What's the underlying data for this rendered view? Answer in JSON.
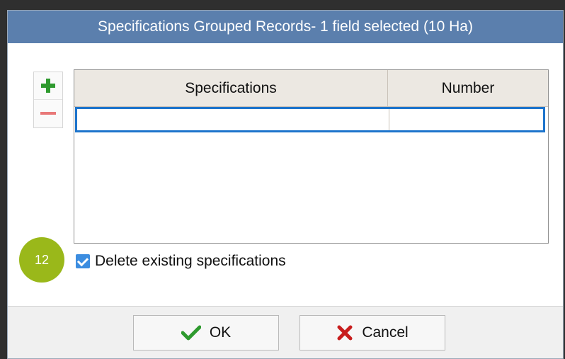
{
  "dialog": {
    "title": "Specifications Grouped Records- 1 field selected (10 Ha)"
  },
  "grid": {
    "columns": [
      "Specifications",
      "Number"
    ],
    "rows": [
      {
        "specification": "",
        "number": ""
      }
    ]
  },
  "options": {
    "delete_existing_label": "Delete existing specifications",
    "delete_existing_checked": true
  },
  "badge": {
    "number": "12"
  },
  "buttons": {
    "ok_label": "OK",
    "cancel_label": "Cancel"
  },
  "colors": {
    "titlebar": "#5b7fad",
    "accent": "#1d74cc",
    "add_icon": "#2e9a2e",
    "remove_icon": "#e87878",
    "badge": "#9ab81a",
    "cancel_icon": "#c81e1e",
    "ok_icon": "#2e9a2e"
  },
  "icons": {
    "add": "plus-icon",
    "remove": "minus-icon",
    "ok": "check-icon",
    "cancel": "cross-icon"
  }
}
